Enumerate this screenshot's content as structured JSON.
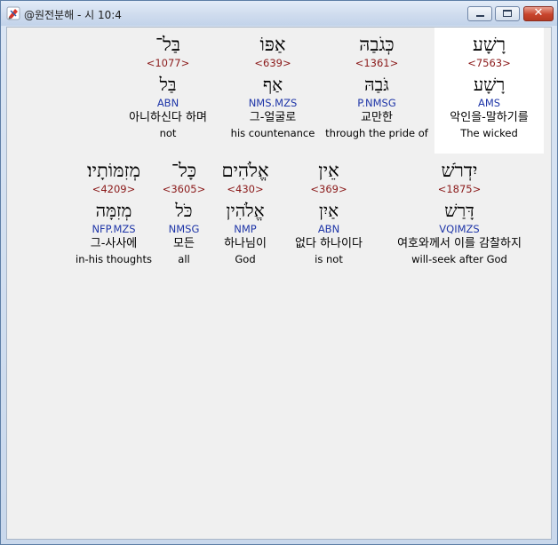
{
  "window": {
    "title": "@원전분해 - 시 10:4",
    "close_glyph": "✕"
  },
  "rows": [
    [
      {
        "hebrew": "בַּל־",
        "strong": "<1077>",
        "root": "בַּל",
        "morph": "ABN",
        "korean": "아니하신다 하며",
        "english": "not"
      },
      {
        "hebrew": "אַפּוֹ",
        "strong": "<639>",
        "root": "אַף",
        "morph": "NMS.MZS",
        "korean": "그-얼굴로",
        "english": "his countenance"
      },
      {
        "hebrew": "כְּגֹבַהּ",
        "strong": "<1361>",
        "root": "גֹּבַהּ",
        "morph": "P.NMSG",
        "korean": "교만한",
        "english": "through the pride of"
      },
      {
        "hebrew": "רָשָׁע",
        "strong": "<7563>",
        "root": "רָשָׁע",
        "morph": "AMS",
        "korean": "악인을-말하기를",
        "english": "The wicked",
        "selected": true
      }
    ],
    [
      {
        "hebrew": "מְזִמּוֹתָיו׃",
        "strong": "<4209>",
        "root": "מְזִמָּה",
        "morph": "NFP.MZS",
        "korean": "그-사사에",
        "english": "in-his thoughts"
      },
      {
        "hebrew": "כָּל־",
        "strong": "<3605>",
        "root": "כֹּל",
        "morph": "NMSG",
        "korean": "모든",
        "english": "all"
      },
      {
        "hebrew": "אֱלֹהִים",
        "strong": "<430>",
        "root": "אֱלֹהִין",
        "morph": "NMP",
        "korean": "하나님이",
        "english": "God"
      },
      {
        "hebrew": "אֵין",
        "strong": "<369>",
        "root": "אַיִן",
        "morph": "ABN",
        "korean": "없다 하나이다",
        "english": "is not"
      },
      {
        "hebrew": "יִדְרֹשׁ",
        "strong": "<1875>",
        "root": "דָּרַשׁ",
        "morph": "VQIMZS",
        "korean": "여호와께서 이를 감찰하지",
        "english": "will-seek after God"
      }
    ]
  ]
}
